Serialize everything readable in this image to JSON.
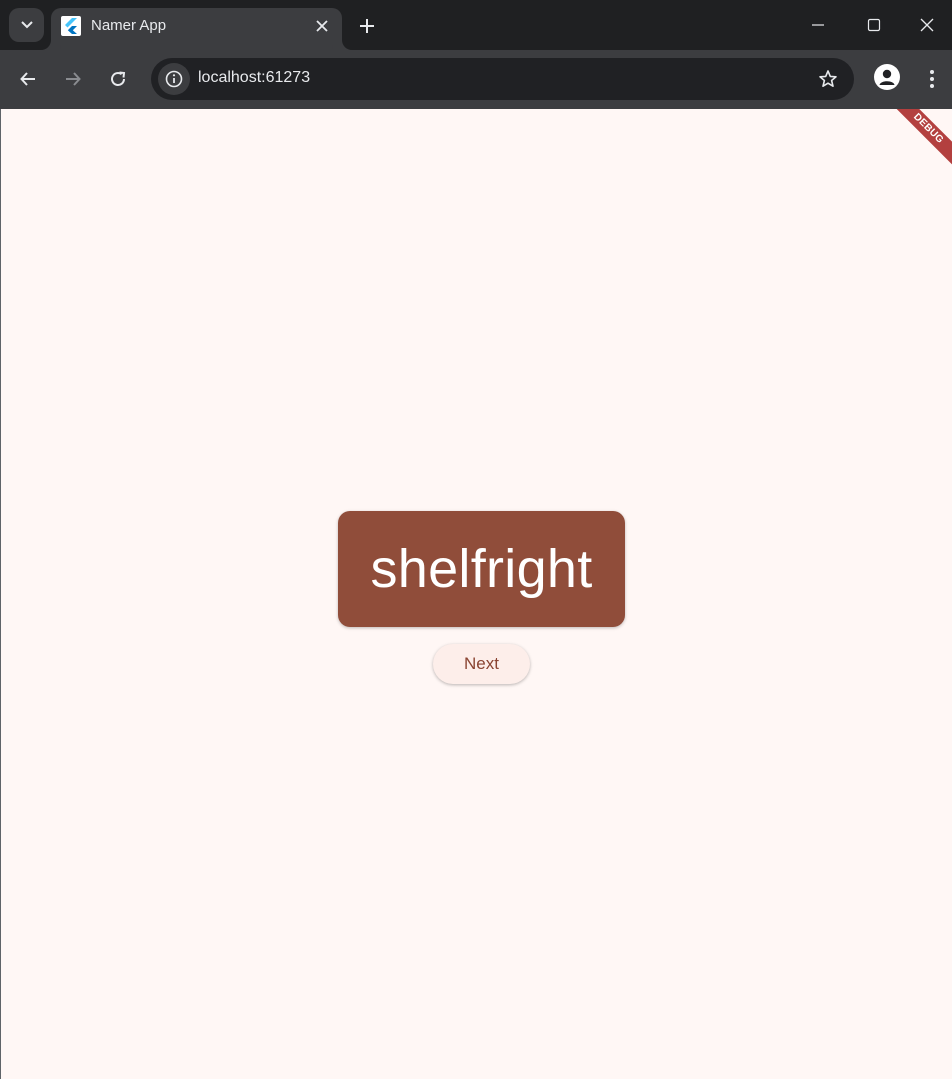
{
  "browser": {
    "tab": {
      "title": "Namer App"
    },
    "address": {
      "url": "localhost:61273"
    },
    "icons": {
      "tab_search": "chevron-down-icon",
      "favicon": "flutter-logo-icon",
      "tab_close": "close-icon",
      "new_tab": "plus-icon",
      "back": "arrow-left-icon",
      "forward": "arrow-right-icon",
      "reload": "reload-icon",
      "site_info": "info-icon",
      "bookmark": "star-icon",
      "profile": "person-icon",
      "menu": "kebab-menu-icon",
      "minimize": "minimize-icon",
      "maximize": "maximize-icon",
      "close_window": "close-icon"
    }
  },
  "app": {
    "debug_banner": "DEBUG",
    "word": "shelfright",
    "next_label": "Next",
    "colors": {
      "background": "#fff7f5",
      "card": "#904d3a",
      "button_bg": "#fdeeea",
      "button_text": "#8a4432",
      "debug_banner": "#b3403f"
    }
  }
}
